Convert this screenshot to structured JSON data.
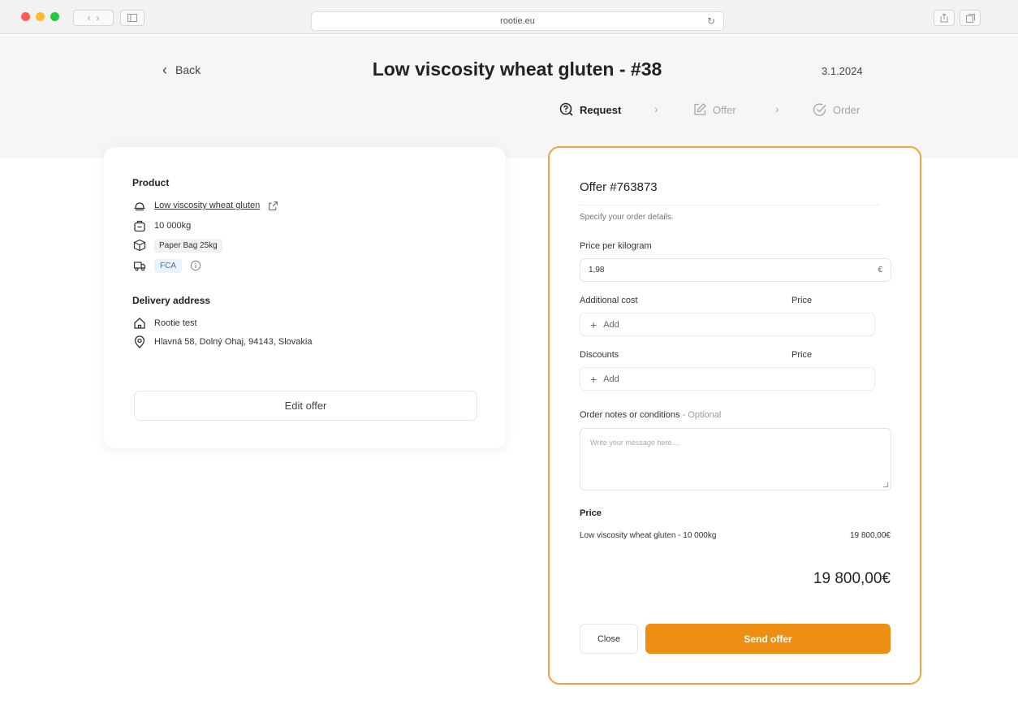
{
  "browser": {
    "url": "rootie.eu",
    "traffic_lights": [
      "#fc5b57",
      "#fdbc2e",
      "#27c840"
    ]
  },
  "header": {
    "back_label": "Back",
    "title": "Low viscosity wheat gluten - #38",
    "date": "3.1.2024"
  },
  "steps": [
    {
      "label": "Request",
      "icon": "request-icon",
      "active": true
    },
    {
      "label": "Offer",
      "icon": "edit-icon",
      "active": false
    },
    {
      "label": "Order",
      "icon": "check-icon",
      "active": false
    }
  ],
  "product": {
    "section_title": "Product",
    "name": "Low viscosity wheat gluten",
    "quantity": "10 000kg",
    "packaging": "Paper Bag 25kg",
    "incoterm": "FCA"
  },
  "delivery": {
    "section_title": "Delivery address",
    "company": "Rootie test",
    "address": "Hlavná 58, Dolný Ohaj, 94143, Slovakia"
  },
  "edit_offer_label": "Edit offer",
  "offer": {
    "title": "Offer #763873",
    "subtitle": "Specify your order details.",
    "price_per_kg_label": "Price per kilogram",
    "price_per_kg_value": "1,98",
    "currency": "€",
    "additional_cost_label": "Additional cost",
    "price_label": "Price",
    "add_label": "Add",
    "discounts_label": "Discounts",
    "notes_label": "Order notes or conditions",
    "notes_optional": "- Optional",
    "notes_placeholder": "Write your message here ...",
    "price_section_title": "Price",
    "line_item_label": "Low viscosity wheat gluten - 10 000kg",
    "line_item_amount": "19 800,00€",
    "total": "19 800,00€",
    "close_label": "Close",
    "send_label": "Send offer"
  },
  "colors": {
    "accent": "#ee8f14",
    "card_border": "#efa23c"
  }
}
